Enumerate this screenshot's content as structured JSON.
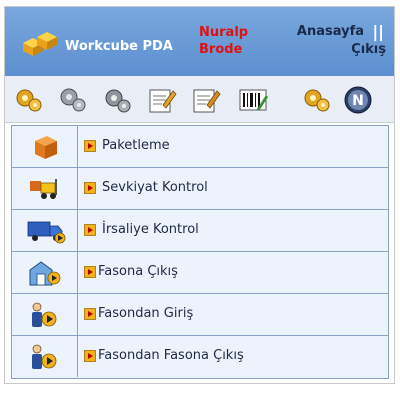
{
  "header": {
    "app_name": "Workcube PDA",
    "user_name_line1": "Nuralp",
    "user_name_line2": "Brode",
    "home_label": "Anasayfa",
    "separator": "||",
    "logout_label": "Çıkış"
  },
  "toolbar": {
    "buttons": [
      {
        "icon": "puzzle-gear-icon"
      },
      {
        "icon": "gears-icon"
      },
      {
        "icon": "gears-alt-icon"
      },
      {
        "icon": "edit-form-icon"
      },
      {
        "icon": "edit-form-alt-icon"
      },
      {
        "icon": "barcode-icon"
      },
      {
        "icon": "puzzle-gear-alt-icon"
      },
      {
        "icon": "compass-icon"
      }
    ]
  },
  "menu": {
    "items": [
      {
        "label": "Paketleme",
        "icon": "package-box-icon"
      },
      {
        "label": "Sevkiyat Kontrol",
        "icon": "forklift-icon"
      },
      {
        "label": "İrsaliye Kontrol",
        "icon": "delivery-truck-icon"
      },
      {
        "label": "Fasona Çıkış",
        "icon": "warehouse-exit-icon"
      },
      {
        "label": "Fasondan Giriş",
        "icon": "person-entry-icon"
      },
      {
        "label": "Fasondan Fasona Çıkış",
        "icon": "person-transfer-icon"
      }
    ]
  },
  "colors": {
    "header_bg": "#6a9bd8",
    "user_name": "#e01010",
    "menu_bg": "#edf3fc",
    "menu_border": "#8aa0c4",
    "arrow": "#f1b21c"
  }
}
